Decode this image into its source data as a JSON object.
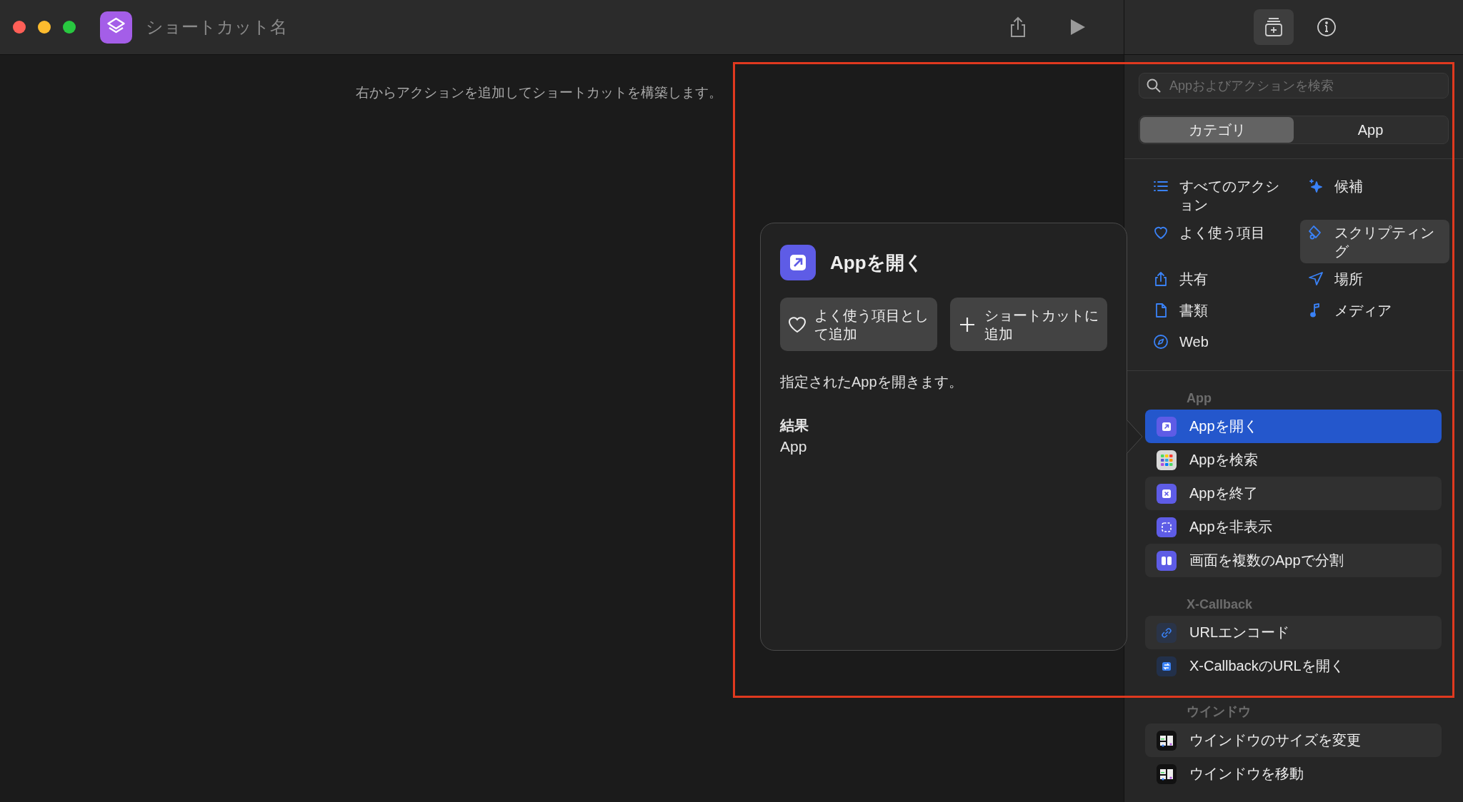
{
  "window": {
    "title": "ショートカット名"
  },
  "editor": {
    "hint": "右からアクションを追加してショートカットを構築します。"
  },
  "popover": {
    "title": "Appを開く",
    "buttons": [
      {
        "kind": "favorite",
        "label": "よく使う項目として追加"
      },
      {
        "kind": "add",
        "label": "ショートカットに追加"
      }
    ],
    "description": "指定されたAppを開きます。",
    "result_label": "結果",
    "result_value": "App"
  },
  "sidebar": {
    "search": {
      "placeholder": "Appおよびアクションを検索"
    },
    "segments": [
      {
        "label": "カテゴリ",
        "selected": true
      },
      {
        "label": "App",
        "selected": false
      }
    ],
    "categories": [
      {
        "kind": "all",
        "label": "すべてのアクション",
        "selected": false
      },
      {
        "kind": "suggestions",
        "label": "候補",
        "selected": false
      },
      {
        "kind": "favorites",
        "label": "よく使う項目",
        "selected": false
      },
      {
        "kind": "scripting",
        "label": "スクリプティング",
        "selected": true
      },
      {
        "kind": "sharing",
        "label": "共有",
        "selected": false
      },
      {
        "kind": "location",
        "label": "場所",
        "selected": false
      },
      {
        "kind": "documents",
        "label": "書類",
        "selected": false
      },
      {
        "kind": "media",
        "label": "メディア",
        "selected": false
      },
      {
        "kind": "web",
        "label": "Web",
        "selected": false
      }
    ],
    "sections": [
      {
        "title": "App",
        "actions": [
          {
            "kind": "open",
            "label": "Appを開く",
            "selected": true
          },
          {
            "kind": "find",
            "label": "Appを検索",
            "selected": false
          },
          {
            "kind": "quit",
            "label": "Appを終了",
            "selected": false
          },
          {
            "kind": "hide",
            "label": "Appを非表示",
            "selected": false
          },
          {
            "kind": "split",
            "label": "画面を複数のAppで分割",
            "selected": false
          }
        ]
      },
      {
        "title": "X-Callback",
        "actions": [
          {
            "kind": "link",
            "label": "URLエンコード",
            "selected": false
          },
          {
            "kind": "callback",
            "label": "X-CallbackのURLを開く",
            "selected": false
          }
        ]
      },
      {
        "title": "ウインドウ",
        "actions": [
          {
            "kind": "window",
            "label": "ウインドウのサイズを変更",
            "selected": false
          },
          {
            "kind": "window",
            "label": "ウインドウを移動",
            "selected": false
          }
        ]
      }
    ]
  }
}
